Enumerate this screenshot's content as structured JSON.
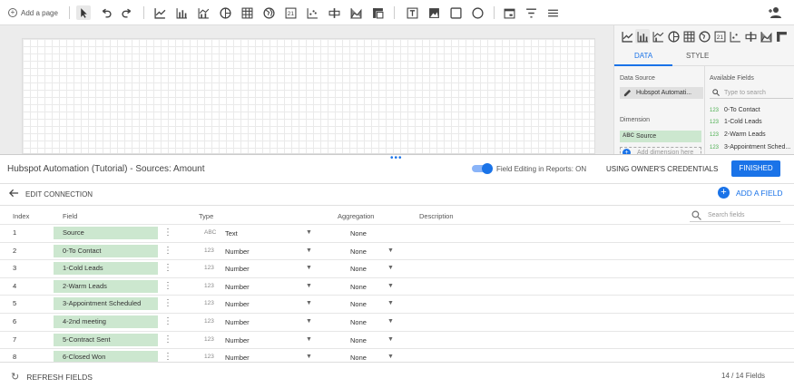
{
  "toolbar": {
    "add_page_label": "Add a page"
  },
  "panel": {
    "tabs": [
      "DATA",
      "STYLE"
    ],
    "data_source_label": "Data Source",
    "data_source_name": "Hubspot Automati...",
    "dimension_label": "Dimension",
    "dimension_value": "Source",
    "dimension_type": "ABC",
    "add_dimension": "Add dimension here",
    "available_fields_label": "Available Fields",
    "search_placeholder": "Type to search",
    "available_fields": [
      {
        "type": "123",
        "name": "0-To Contact"
      },
      {
        "type": "123",
        "name": "1-Cold Leads"
      },
      {
        "type": "123",
        "name": "2-Warm Leads"
      },
      {
        "type": "123",
        "name": "3-Appointment Sched..."
      }
    ]
  },
  "editor": {
    "title": "Hubspot Automation (Tutorial) - Sources: Amount",
    "field_editing_label": "Field Editing in Reports: ON",
    "owner_credentials": "USING OWNER'S CREDENTIALS",
    "finished": "FINISHED",
    "edit_connection": "EDIT CONNECTION",
    "add_field": "ADD A FIELD",
    "columns": {
      "index": "Index",
      "field": "Field",
      "type": "Type",
      "aggregation": "Aggregation",
      "description": "Description"
    },
    "search_fields_placeholder": "Search fields",
    "rows": [
      {
        "index": "1",
        "field": "Source",
        "type_icon": "ABC",
        "type": "Text",
        "aggregation": "None",
        "agg_dropdown": false
      },
      {
        "index": "2",
        "field": "0-To Contact",
        "type_icon": "123",
        "type": "Number",
        "aggregation": "None",
        "agg_dropdown": true
      },
      {
        "index": "3",
        "field": "1-Cold Leads",
        "type_icon": "123",
        "type": "Number",
        "aggregation": "None",
        "agg_dropdown": true
      },
      {
        "index": "4",
        "field": "2-Warm Leads",
        "type_icon": "123",
        "type": "Number",
        "aggregation": "None",
        "agg_dropdown": true
      },
      {
        "index": "5",
        "field": "3-Appointment Scheduled",
        "type_icon": "123",
        "type": "Number",
        "aggregation": "None",
        "agg_dropdown": true
      },
      {
        "index": "6",
        "field": "4-2nd meeting",
        "type_icon": "123",
        "type": "Number",
        "aggregation": "None",
        "agg_dropdown": true
      },
      {
        "index": "7",
        "field": "5-Contract Sent",
        "type_icon": "123",
        "type": "Number",
        "aggregation": "None",
        "agg_dropdown": true
      },
      {
        "index": "8",
        "field": "6-Closed Won",
        "type_icon": "123",
        "type": "Number",
        "aggregation": "None",
        "agg_dropdown": true
      }
    ],
    "refresh_fields": "REFRESH FIELDS",
    "field_count": "14 / 14 Fields"
  },
  "colors": {
    "accent": "#1a73e8",
    "field_chip": "#cce7cf"
  }
}
